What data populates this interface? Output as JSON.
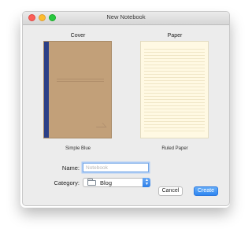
{
  "window": {
    "title": "New Notebook"
  },
  "cover_section": {
    "label": "Cover",
    "selected_cover_name": "Simple Blue"
  },
  "paper_section": {
    "label": "Paper",
    "selected_paper_name": "Ruled Paper"
  },
  "form": {
    "name_label": "Name:",
    "name_placeholder": "Notebook",
    "category_label": "Category:",
    "category_value": "Blog"
  },
  "buttons": {
    "cancel": "Cancel",
    "create": "Create"
  },
  "colors": {
    "cover_brown": "#c2a079",
    "cover_spine_blue": "#2c3f86",
    "primary_button": "#2f86f0",
    "paper": "#fff9e3"
  }
}
